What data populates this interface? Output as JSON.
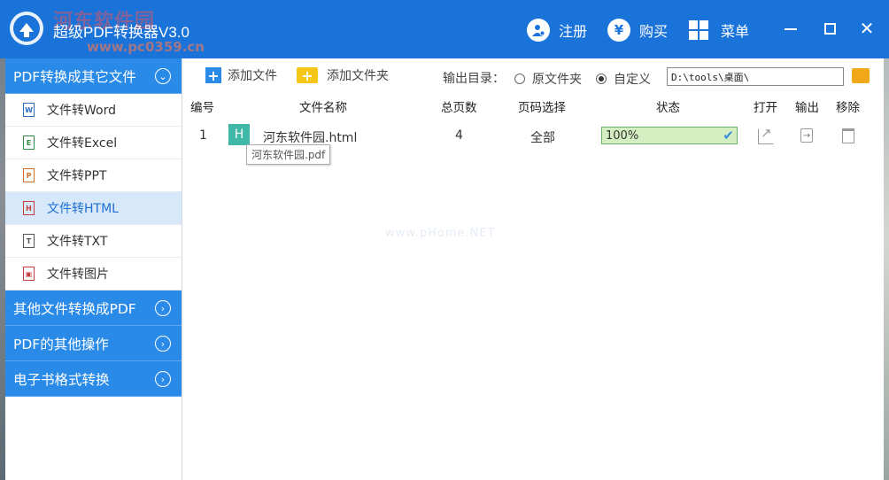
{
  "titlebar": {
    "title": "超级PDF转换器V3.0",
    "watermark": "河东软件园",
    "watermark_url": "www.pc0359.cn",
    "register_label": "注册",
    "buy_label": "购买",
    "menu_label": "菜单",
    "buy_icon_glyph": "¥"
  },
  "sidebar": {
    "category_pdf_to_other": "PDF转换成其它文件",
    "items": [
      {
        "label": "文件转Word",
        "icon": "word-file-icon",
        "glyph": "W"
      },
      {
        "label": "文件转Excel",
        "icon": "excel-file-icon",
        "glyph": "E"
      },
      {
        "label": "文件转PPT",
        "icon": "ppt-file-icon",
        "glyph": "P"
      },
      {
        "label": "文件转HTML",
        "icon": "html-file-icon",
        "glyph": "H"
      },
      {
        "label": "文件转TXT",
        "icon": "txt-file-icon",
        "glyph": "T"
      },
      {
        "label": "文件转图片",
        "icon": "image-file-icon",
        "glyph": "▣"
      }
    ],
    "category_other_to_pdf": "其他文件转换成PDF",
    "category_pdf_ops": "PDF的其他操作",
    "category_ebook": "电子书格式转换"
  },
  "toolbar": {
    "add_file": "添加文件",
    "add_folder": "添加文件夹",
    "output_dir_label": "输出目录：",
    "radio_original": "原文件夹",
    "radio_custom": "自定义",
    "output_path": "D:\\tools\\桌面\\"
  },
  "table": {
    "headers": {
      "index": "编号",
      "filename": "文件名称",
      "pages": "总页数",
      "page_select": "页码选择",
      "status": "状态",
      "open": "打开",
      "output": "输出",
      "remove": "移除"
    },
    "rows": [
      {
        "index": "1",
        "badge": "H",
        "filename": "河东软件园.html",
        "pages": "4",
        "page_select": "全部",
        "progress_text": "100%",
        "progress": 1.0,
        "tooltip": "河东软件园.pdf"
      }
    ]
  },
  "main_watermark": "www.pHome.NET",
  "colors": {
    "titlebar": "#1a73d9",
    "sidebar_category": "#2a8ae8",
    "active_item_bg": "#d6e8fa",
    "progress_border": "#6db36d"
  }
}
